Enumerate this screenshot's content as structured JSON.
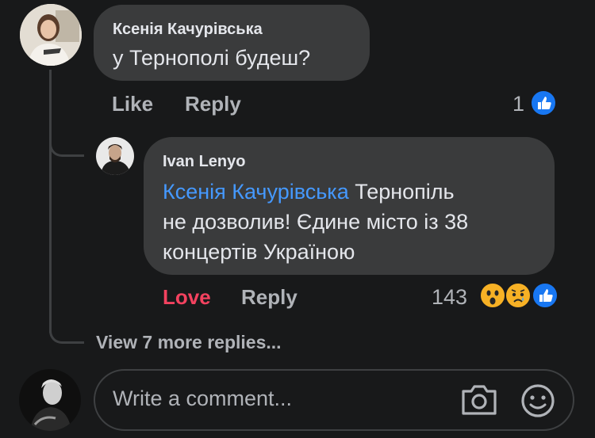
{
  "comment": {
    "author": "Ксенія Качурівська",
    "text": "у Тернополі будеш?",
    "like_label": "Like",
    "reply_label": "Reply",
    "reaction_count": "1",
    "reaction_icons": [
      "like-icon"
    ]
  },
  "reply": {
    "author": "Ivan Lenyo",
    "mention": "Ксенія Качурівська",
    "text_line1_rest": " Тернопіль",
    "text_line2": "не дозволив! Єдине місто із 38",
    "text_line3": "концертів Україною",
    "love_label": "Love",
    "reply_label": "Reply",
    "reaction_count": "143",
    "reaction_icons": [
      "wow-icon",
      "sad-icon",
      "like-icon"
    ]
  },
  "view_more": {
    "label": "View 7 more replies..."
  },
  "composer": {
    "placeholder": "Write a comment...",
    "icons": [
      "camera-icon",
      "sticker-icon"
    ]
  },
  "colors": {
    "background": "#18191a",
    "bubble": "#3a3b3c",
    "accent": "#4599ff",
    "love": "#f3425f",
    "like_blue": "#1877f2"
  }
}
